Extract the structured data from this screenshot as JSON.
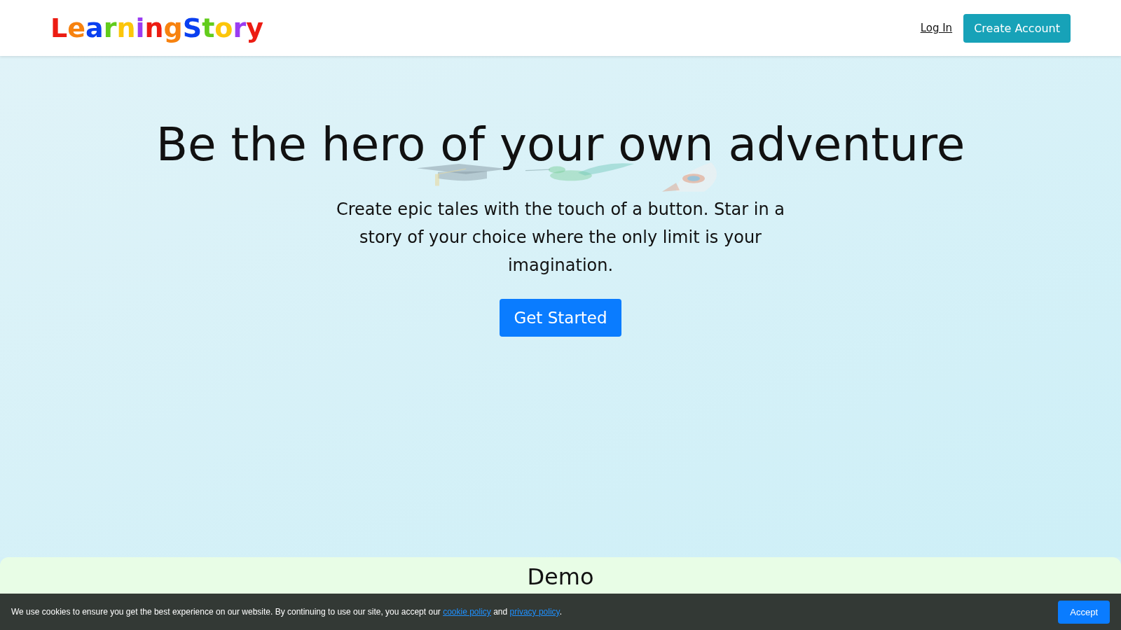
{
  "header": {
    "logo": "LearningStory",
    "login_link": "Log In",
    "signup_button": "Create Account"
  },
  "hero": {
    "title": "Be the hero of your own adventure",
    "subtitle": "Create epic tales with the touch of a button. Star in a story of your choice where the only limit is your imagination.",
    "cta_button": "Get Started"
  },
  "demo": {
    "heading": "Demo"
  },
  "cookie_banner": {
    "text_before": "We use cookies to ensure you get the best experience on our website. By continuing to use our site, you accept our",
    "cookie_link": "cookie policy",
    "text_middle": "and",
    "privacy_link": "privacy policy",
    "text_after": ".",
    "accept_button": "Accept"
  }
}
